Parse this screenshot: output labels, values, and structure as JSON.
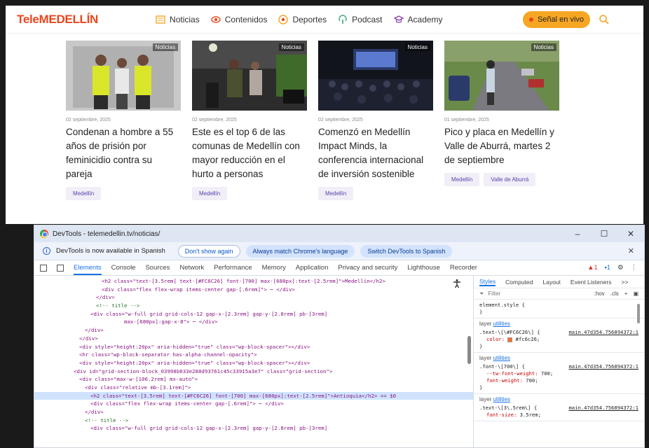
{
  "site": {
    "logo": "TeleMEDELLÍN",
    "nav": [
      {
        "label": "Noticias",
        "icon": "newspaper-icon"
      },
      {
        "label": "Contenidos",
        "icon": "eye-icon"
      },
      {
        "label": "Deportes",
        "icon": "ball-icon"
      },
      {
        "label": "Podcast",
        "icon": "podcast-icon"
      },
      {
        "label": "Academy",
        "icon": "graduation-cap-icon"
      }
    ],
    "live_button": "Señal en vivo",
    "badge": "Noticias",
    "cards": [
      {
        "date": "02 septiembre, 2025",
        "title": "Condenan a hombre a 55 años de prisión por feminicidio contra su pareja",
        "tags": [
          "Medellín"
        ]
      },
      {
        "date": "02 septiembre, 2025",
        "title": "Este es el top 6 de las comunas de Medellín con mayor reducción en el hurto a personas",
        "tags": [
          "Medellín"
        ]
      },
      {
        "date": "02 septiembre, 2025",
        "title": "Comenzó en Medellín Impact Minds, la conferencia internacional de inversión sostenible",
        "tags": [
          "Medellín"
        ]
      },
      {
        "date": "01 septiembre, 2025",
        "title": "Pico y placa en Medellín y Valle de Aburrá, martes 2 de septiembre",
        "tags": [
          "Medellín",
          "Valle de Aburrá"
        ]
      }
    ]
  },
  "devtools": {
    "title": "DevTools - telemedellin.tv/noticias/",
    "banner_text": "DevTools is now available in Spanish",
    "banner_buttons": [
      "Don't show again",
      "Always match Chrome's language",
      "Switch DevTools to Spanish"
    ],
    "tabs": [
      "Elements",
      "Console",
      "Sources",
      "Network",
      "Performance",
      "Memory",
      "Application",
      "Privacy and security",
      "Lighthouse",
      "Recorder"
    ],
    "warnings": "1",
    "messages": "1",
    "styles_tabs": [
      "Styles",
      "Computed",
      "Layout",
      "Event Listeners",
      ">>"
    ],
    "filter_placeholder": "Filter",
    "filter_tools": [
      ":hov",
      ".cls",
      "+"
    ],
    "element_style": "element.style {",
    "close_brace": "}",
    "layer_prefix": "layer",
    "layer_link": "utilities",
    "rules": [
      {
        "selector": ".text-\\[\\#FC6C26\\] {",
        "source": "main.47d354.756894372:1",
        "prop": "color:",
        "value": "#fc6c26;"
      },
      {
        "selector": ".font-\\[700\\] {",
        "source": "main.47d354.756894372:1",
        "prop": "--tw-font-weight:",
        "value": "700;",
        "prop2": "font-weight:",
        "value2": "700;"
      },
      {
        "selector": ".text-\\[3\\.5rem\\] {",
        "source": "main.47d354.756894372:1",
        "prop": "font-size:",
        "value": "3.5rem;"
      }
    ],
    "dom_lines": [
      "<h2 class=\"text-[3.5rem] text-[#FC6C26] font-[700] max-[680px]:text-[2.5rem]\">Medellín</h2>",
      "<div class=\"flex flex-wrap items-center gap-[.6rem]\"> ⋯ </div>",
      "</div>",
      "<!-- title -->",
      "<div class=\"w-full grid grid-cols-12 gap-x-[2.3rem] gap-y-[2.8rem] pb-[3rem]",
      "max-[680px]:gap-x-8\"> ⋯ </div>",
      "</div>",
      "</div>",
      "<div style=\"height:20px\" aria-hidden=\"true\" class=\"wp-block-spacer\"></div>",
      "<hr class=\"wp-block-separator has-alpha-channel-opacity\">",
      "<div style=\"height:20px\" aria-hidden=\"true\" class=\"wp-block-spacer\"></div>",
      "<div id=\"grid-section-block_03998b033e288d93761c45c33915a3e7\" class=\"grid-section\">",
      "<div class=\"max-w-[106.2rem] mx-auto\">",
      "<div class=\"relative mb-[3.1rem]\">",
      "<h2 class=\"text-[3.5rem] text-[#FC6C26] font-[700] max-[680px]:text-[2.5rem]\">Antioquia</h2> == $0",
      "<div class=\"flex flex-wrap items-center gap-[.6rem]\"> ⋯ </div>",
      "</div>",
      "<!-- title -->",
      "<div class=\"w-full grid grid-cols-12 gap-x-[2.3rem] gap-y-[2.8rem] pb-[3rem]"
    ]
  }
}
